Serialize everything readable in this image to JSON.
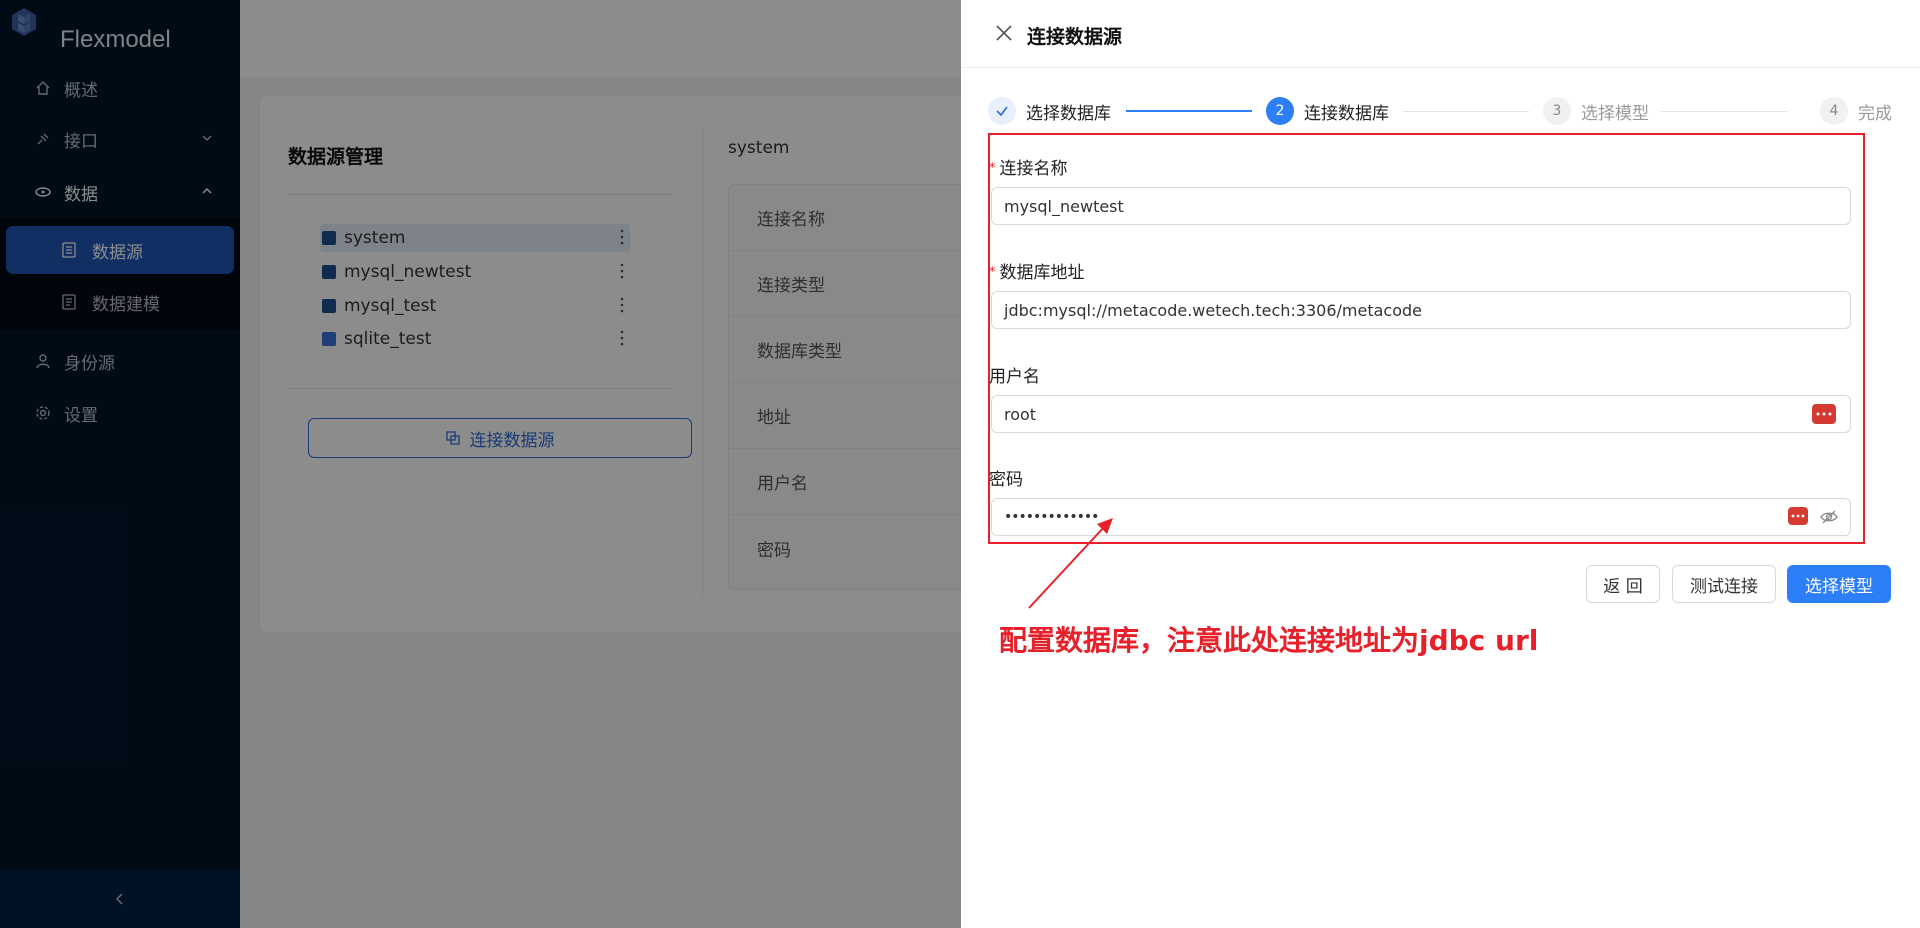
{
  "sidebar": {
    "brand": "Flexmodel",
    "items": [
      {
        "label": "概述",
        "icon": "home-icon"
      },
      {
        "label": "接口",
        "icon": "api-icon"
      },
      {
        "label": "数据",
        "icon": "data-icon"
      },
      {
        "label": "身份源",
        "icon": "user-icon"
      },
      {
        "label": "设置",
        "icon": "gear-icon"
      }
    ],
    "sub_items": [
      {
        "label": "数据源",
        "icon": "database-icon"
      },
      {
        "label": "数据建模",
        "icon": "model-icon"
      }
    ],
    "collapse_icon": "chevron-left-icon"
  },
  "background": {
    "card_title": "数据源管理",
    "datasources": [
      "system",
      "mysql_newtest",
      "mysql_test",
      "sqlite_test"
    ],
    "connect_button": "连接数据源",
    "detail_name": "system",
    "detail_rows": [
      "连接名称",
      "连接类型",
      "数据库类型",
      "地址",
      "用户名",
      "密码"
    ]
  },
  "drawer": {
    "title": "连接数据源",
    "steps": [
      {
        "num": "✓",
        "label": "选择数据库",
        "status": "done"
      },
      {
        "num": "2",
        "label": "连接数据库",
        "status": "active"
      },
      {
        "num": "3",
        "label": "选择模型",
        "status": "wait"
      },
      {
        "num": "4",
        "label": "完成",
        "status": "wait"
      }
    ],
    "form": {
      "connection_name_label": "连接名称",
      "connection_name_value": "mysql_newtest",
      "db_url_label": "数据库地址",
      "db_url_value": "jdbc:mysql://metacode.wetech.tech:3306/metacode",
      "username_label": "用户名",
      "username_value": "root",
      "password_label": "密码",
      "password_value": "•••••••••••••"
    },
    "buttons": {
      "back": "返 回",
      "test": "测试连接",
      "next": "选择模型"
    },
    "annotation": "配置数据库，注意此处连接地址为jdbc url"
  },
  "colors": {
    "sidebar_bg": "#001529",
    "primary": "#2d7ff9",
    "annotation_red": "#e8202a"
  }
}
